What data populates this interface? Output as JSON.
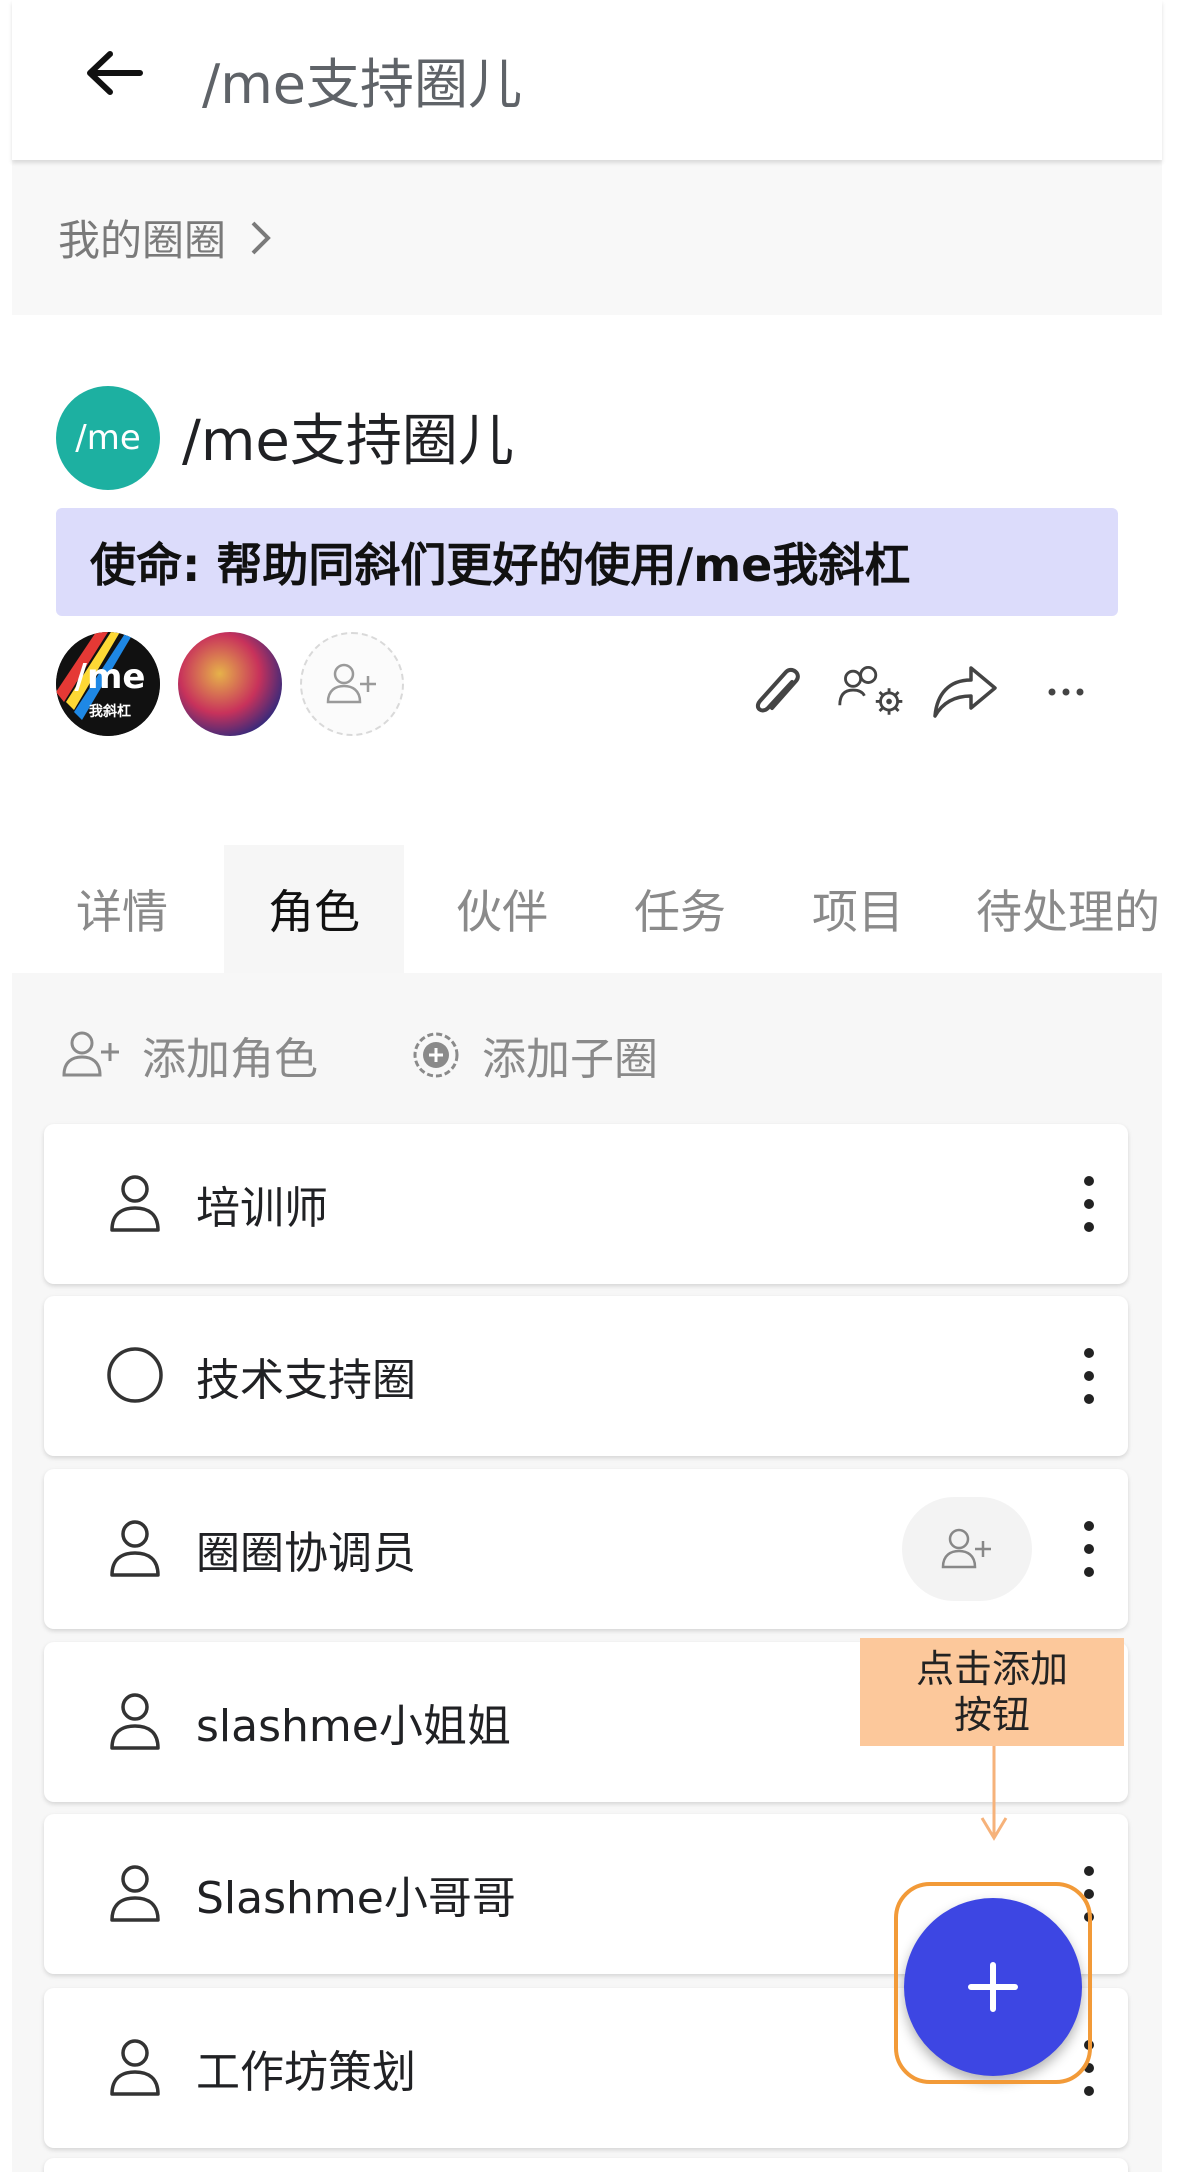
{
  "header": {
    "title": "/me支持圈儿",
    "back_icon": "arrow-left-icon"
  },
  "breadcrumb": {
    "label": "我的圈圈"
  },
  "circle": {
    "avatar_text": "/me",
    "avatar_color": "#1db0a1",
    "name": "/me支持圈儿",
    "mission": "使命: 帮助同斜们更好的使用/me我斜杠"
  },
  "members": {
    "member1_logo_text": "/me",
    "member1_logo_subtext": "我斜杠"
  },
  "actions": {
    "icons": [
      "paperclip-icon",
      "people-settings-icon",
      "share-icon",
      "more-horizontal-icon"
    ]
  },
  "tabs": [
    {
      "label": "详情"
    },
    {
      "label": "角色"
    },
    {
      "label": "伙伴"
    },
    {
      "label": "任务"
    },
    {
      "label": "项目"
    },
    {
      "label": "待处理的"
    }
  ],
  "active_tab": "角色",
  "quick_actions": {
    "add_role": "添加角色",
    "add_subcircle": "添加子圈"
  },
  "roles": [
    {
      "label": "培训师",
      "icon": "person-icon"
    },
    {
      "label": "技术支持圈",
      "icon": "circle-icon"
    },
    {
      "label": "圈圈协调员",
      "icon": "person-icon"
    },
    {
      "label": "slashme小姐姐",
      "icon": "person-icon"
    },
    {
      "label": "Slashme小哥哥",
      "icon": "person-icon"
    },
    {
      "label": "工作坊策划",
      "icon": "person-icon"
    }
  ],
  "callout": {
    "line1": "点击添加",
    "line2": "按钮"
  },
  "colors": {
    "fab": "#3d46e3",
    "mission_bg": "#dcdcfb",
    "callout_bg": "#fcc89b",
    "highlight": "#f29a38"
  }
}
